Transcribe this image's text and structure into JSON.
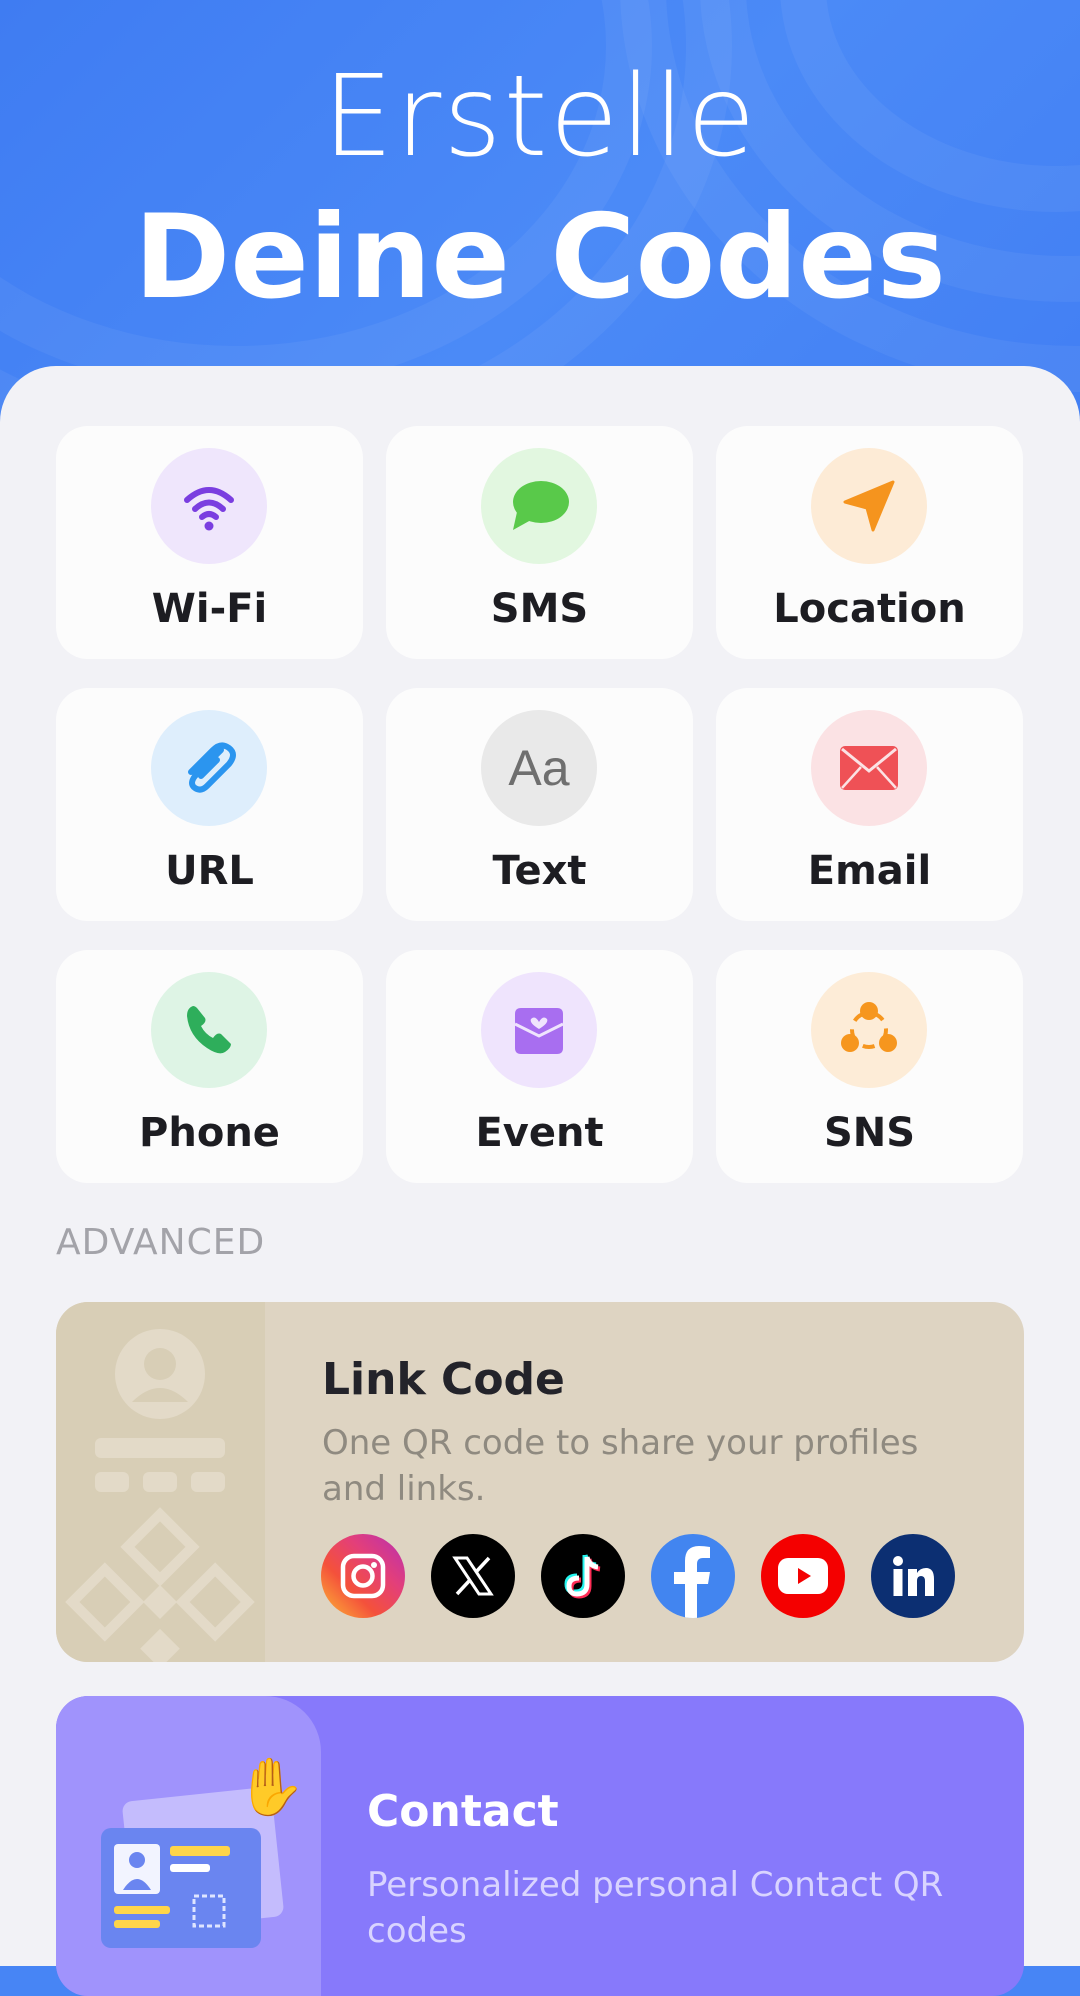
{
  "hero": {
    "title_line1": "Erstelle",
    "title_line2": "Deine Codes"
  },
  "tiles": [
    {
      "label": "Wi-Fi",
      "icon": "wifi-icon",
      "color": "#7a3ee0"
    },
    {
      "label": "SMS",
      "icon": "chat-bubble-icon",
      "color": "#59c94a"
    },
    {
      "label": "Location",
      "icon": "location-arrow-icon",
      "color": "#f5941e"
    },
    {
      "label": "URL",
      "icon": "paperclip-icon",
      "color": "#2b95ef"
    },
    {
      "label": "Text",
      "icon": "text-aa-icon",
      "glyph": "Aa",
      "color": "#6f6f6f"
    },
    {
      "label": "Email",
      "icon": "envelope-icon",
      "color": "#ef5156"
    },
    {
      "label": "Phone",
      "icon": "phone-icon",
      "color": "#2eae5b"
    },
    {
      "label": "Event",
      "icon": "calendar-heart-icon",
      "color": "#a86ef0"
    },
    {
      "label": "SNS",
      "icon": "share-nodes-icon",
      "color": "#f6961e"
    }
  ],
  "advanced": {
    "section_label": "ADVANCED",
    "link_code": {
      "title": "Link Code",
      "description": "One QR code to share your profiles and links.",
      "socials": [
        {
          "name": "instagram-icon",
          "color": "#e33f7a"
        },
        {
          "name": "x-icon",
          "color": "#000000"
        },
        {
          "name": "tiktok-icon",
          "color": "#000000"
        },
        {
          "name": "facebook-icon",
          "color": "#4285f0"
        },
        {
          "name": "youtube-icon",
          "color": "#f40000"
        },
        {
          "name": "linkedin-icon",
          "color": "#0c2f72"
        }
      ]
    },
    "contact": {
      "title": "Contact",
      "description": "Personalized personal Contact QR codes"
    }
  }
}
